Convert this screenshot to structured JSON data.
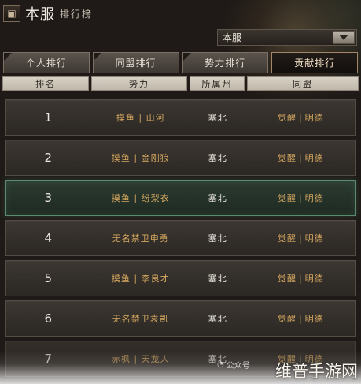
{
  "header": {
    "title": "本服",
    "subtitle": "排行榜"
  },
  "server_select": {
    "selected": "本服"
  },
  "tabs": [
    {
      "label": "个人排行",
      "active": false
    },
    {
      "label": "同盟排行",
      "active": false
    },
    {
      "label": "势力排行",
      "active": false
    },
    {
      "label": "贡献排行",
      "active": true
    }
  ],
  "table": {
    "columns": [
      "排名",
      "势力",
      "所属州",
      "同盟"
    ],
    "rows": [
      {
        "rank": "1",
        "force": "摸鱼 | 山河",
        "state": "塞北",
        "alliance_a": "觉醒",
        "alliance_b": "明德"
      },
      {
        "rank": "2",
        "force": "摸鱼 | 金刚狼",
        "state": "塞北",
        "alliance_a": "觉醒",
        "alliance_b": "明德"
      },
      {
        "rank": "3",
        "force": "摸鱼 | 纷梨衣",
        "state": "塞北",
        "alliance_a": "觉醒",
        "alliance_b": "明德"
      },
      {
        "rank": "4",
        "force": "无名禁卫申勇",
        "state": "塞北",
        "alliance_a": "觉醒",
        "alliance_b": "明德"
      },
      {
        "rank": "5",
        "force": "摸鱼 | 李良才",
        "state": "塞北",
        "alliance_a": "觉醒",
        "alliance_b": "明德"
      },
      {
        "rank": "6",
        "force": "无名禁卫袁凯",
        "state": "塞北",
        "alliance_a": "觉醒",
        "alliance_b": "明德"
      },
      {
        "rank": "7",
        "force": "赤枫 | 天龙人",
        "state": "塞北",
        "alliance_a": "觉醒",
        "alliance_b": "明德"
      }
    ]
  },
  "watermark": {
    "wechat": "公众号",
    "brand": "维普手游网"
  },
  "colors": {
    "accent": "#d6a85f",
    "highlight_border": "#5c8a6e",
    "tab_active_border": "#a38567"
  }
}
